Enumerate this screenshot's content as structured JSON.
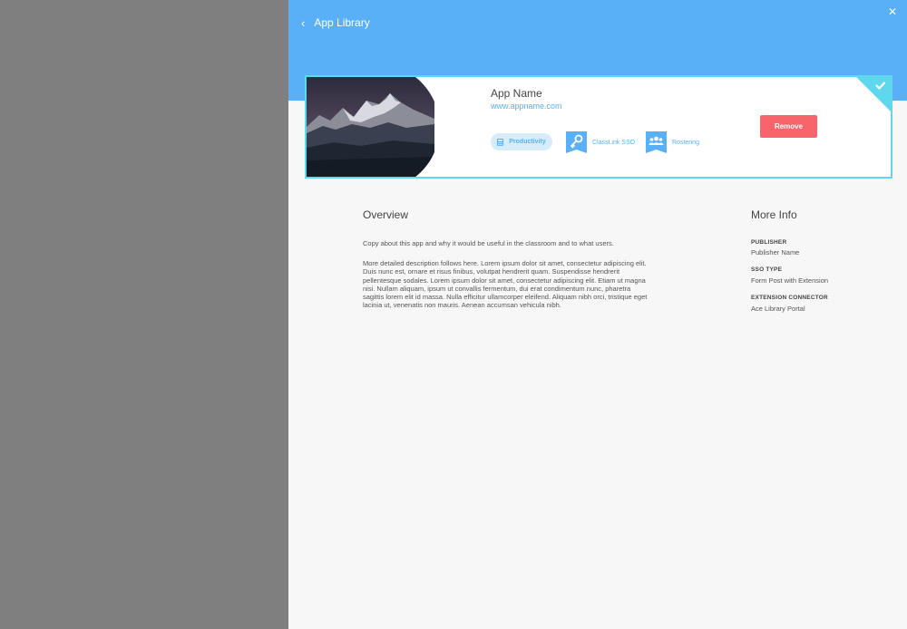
{
  "header": {
    "back_icon": "chevron-left-icon",
    "title": "App Library",
    "close_icon": "close-icon",
    "background_color": "#5ab0f6"
  },
  "app_card": {
    "image_description": "mountain-landscape-image",
    "name": "App Name",
    "url": "www.appname.com",
    "category_tag": {
      "icon": "calculator-icon",
      "label": "Productivity"
    },
    "features": [
      {
        "icon": "key-icon",
        "label": "ClassLink SSO"
      },
      {
        "icon": "users-icon",
        "label": "Rostering"
      }
    ],
    "remove_label": "Remove",
    "added_badge_icon": "checkmark-icon",
    "border_color": "#5fd8ee",
    "remove_color": "#f7656a"
  },
  "overview": {
    "title": "Overview",
    "intro": "Copy about this app and why it would be useful in the classroom and to what users.",
    "description": "More detailed description follows here. Lorem ipsum dolor sit amet, consectetur adipiscing elit. Duis nunc est, ornare et risus finibus, volutpat hendrerit quam. Suspendisse hendrerit pellentesque sodales. Lorem ipsum dolor sit amet, consectetur adipiscing elit. Etiam ut magna nisi. Nullam aliquam, ipsum ut convallis fermentum, dui erat condimentum nunc, pharetra sagittis lorem elit id massa. Nulla efficitur ullamcorper eleifend. Aliquam nibh orci, tristique eget lacinia ut, venenatis non mauris. Aenean accumsan vehicula nibh."
  },
  "more_info": {
    "title": "More Info",
    "items": [
      {
        "label": "PUBLISHER",
        "value": "Publisher Name"
      },
      {
        "label": "SSO TYPE",
        "value": "Form Post with Extension"
      },
      {
        "label": "EXTENSION CONNECTOR",
        "value": "Ace Library Portal"
      }
    ]
  }
}
